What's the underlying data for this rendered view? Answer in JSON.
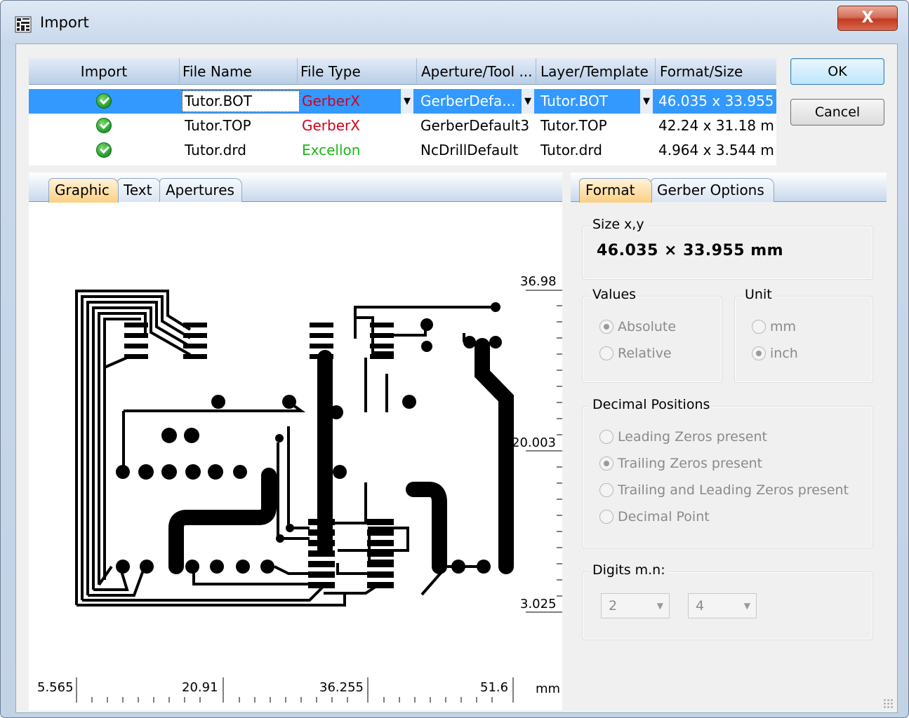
{
  "window": {
    "title": "Import",
    "close_label": "X"
  },
  "table": {
    "columns": [
      "Import",
      "File Name",
      "File Type",
      "Aperture/Tool ...",
      "Layer/Template",
      "Format/Size"
    ],
    "rows": [
      {
        "file_name": "Tutor.BOT",
        "file_type": "GerberX",
        "aperture": "GerberDefa...",
        "layer": "Tutor.BOT",
        "size": "46.035 x 33.955 ..."
      },
      {
        "file_name": "Tutor.TOP",
        "file_type": "GerberX",
        "aperture": "GerberDefault3",
        "layer": "Tutor.TOP",
        "size": "42.24 x 31.18 m..."
      },
      {
        "file_name": "Tutor.drd",
        "file_type": "Excellon",
        "aperture": "NcDrillDefault",
        "layer": "Tutor.drd",
        "size": "4.964 x 3.544 m..."
      }
    ],
    "type_colors": {
      "GerberX": "#d4001a",
      "Excellon": "#18b818"
    }
  },
  "buttons": {
    "ok": "OK",
    "cancel": "Cancel"
  },
  "left_tabs": [
    "Graphic",
    "Text",
    "Apertures"
  ],
  "right_tabs": [
    "Format",
    "Gerber Options"
  ],
  "graphic": {
    "y_labels": [
      "36.98",
      "20.003",
      "3.025"
    ],
    "x_labels": [
      "5.565",
      "20.91",
      "36.255",
      "51.6"
    ],
    "unit": "mm"
  },
  "format": {
    "size_title": "Size x,y",
    "size_value": "46.035 × 33.955 mm",
    "values_title": "Values",
    "absolute": "Absolute",
    "relative": "Relative",
    "unit_title": "Unit",
    "mm": "mm",
    "inch": "inch",
    "decimal_title": "Decimal Positions",
    "leading": "Leading Zeros present",
    "trailing": "Trailing Zeros present",
    "trailing_leading": "Trailing and Leading Zeros present",
    "decimal_point": "Decimal Point",
    "digits_title": "Digits m.n:",
    "digit_m": "2",
    "digit_n": "4"
  }
}
